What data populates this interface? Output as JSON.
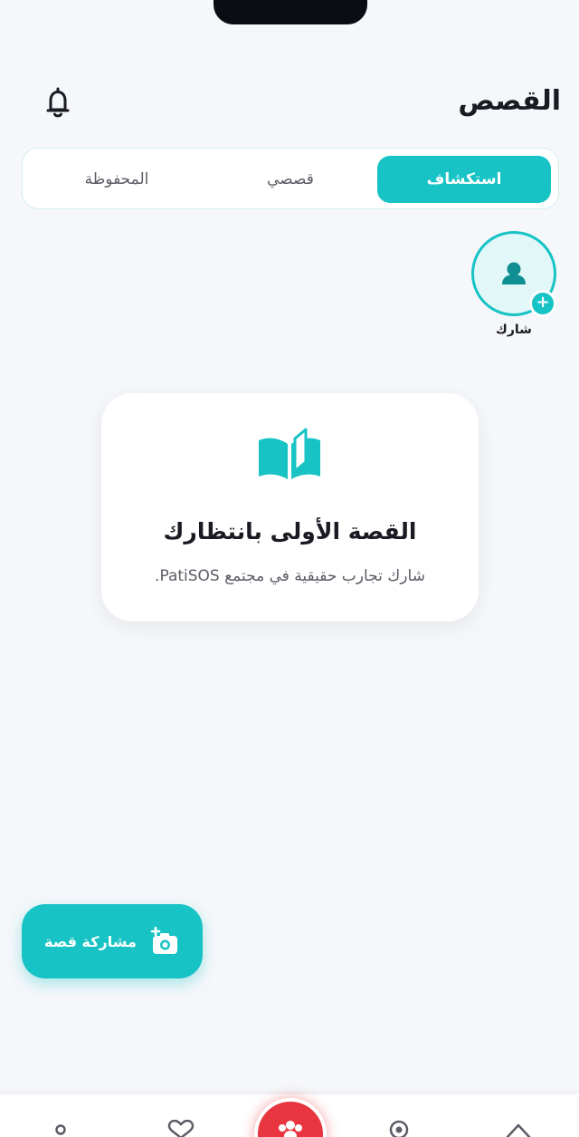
{
  "header": {
    "title": "القصص",
    "notification_icon": "bell-icon"
  },
  "tabs": [
    {
      "label": "استكشاف",
      "active": true
    },
    {
      "label": "قصصي",
      "active": false
    },
    {
      "label": "المحفوظة",
      "active": false
    }
  ],
  "story_add": {
    "label": "شارك",
    "icon": "user-icon",
    "badge_icon": "plus-icon"
  },
  "empty_state": {
    "icon": "book-icon",
    "title": "القصة الأولى بانتظارك",
    "subtitle": "شارك تجارب حقيقية في مجتمع PatiSOS."
  },
  "fab": {
    "label": "مشاركة قصة",
    "icon": "add-photo-icon"
  },
  "bottom_nav": {
    "items": [
      "profile-icon",
      "heart-icon",
      "paw-icon",
      "location-icon",
      "home-icon"
    ]
  },
  "colors": {
    "accent": "#17c3c5",
    "sos": "#e8353f",
    "background": "#f5f7fa"
  }
}
